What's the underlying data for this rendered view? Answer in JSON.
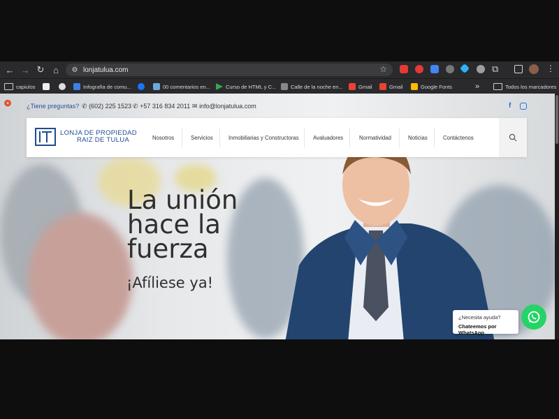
{
  "browser": {
    "url": "lonjatulua.com",
    "bookmarks": [
      {
        "label": "capiulos"
      },
      {
        "label": ""
      },
      {
        "label": ""
      },
      {
        "label": "Infografía de comu..."
      },
      {
        "label": ""
      },
      {
        "label": "00 comentarios en..."
      },
      {
        "label": "Curso de HTML y C..."
      },
      {
        "label": "Calle de la noche en..."
      },
      {
        "label": "Gmail"
      },
      {
        "label": "Gmail"
      },
      {
        "label": "Google Fonts"
      }
    ],
    "all_bookmarks": "Todos los marcadores",
    "more_bookmarks": "»"
  },
  "site": {
    "ask": "¿Tiene preguntas?",
    "phone1": "(602) 225 1523",
    "phone2": "+57 316 834 2011",
    "email": "info@lonjatulua.com",
    "brand_line1": "LONJA DE PROPIEDAD",
    "brand_line2": "RAIZ DE TULUA",
    "menu": [
      "Nosotros",
      "Servicios",
      "Inmobiliarias y Constructoras",
      "Avaluadores",
      "Normatividad",
      "Noticias",
      "Contáctenos"
    ]
  },
  "hero": {
    "line1": "La unión",
    "line2": "hace la",
    "line3": "fuerza",
    "cta": "¡Afíliese ya!"
  },
  "whatsapp": {
    "need_help": "¿Necesita ayuda?",
    "chat": "Chateemos por WhatsApp"
  },
  "colors": {
    "brand_blue": "#1d4b8f",
    "whatsapp_green": "#25d366",
    "chrome_dark": "#2a2a2d"
  }
}
